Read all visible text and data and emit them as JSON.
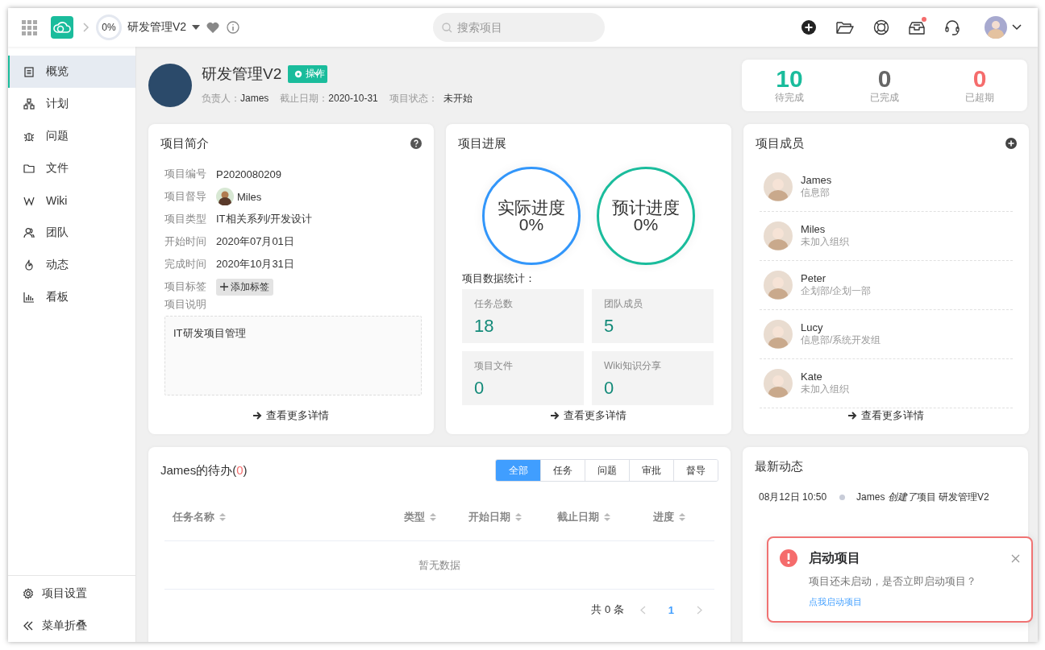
{
  "topbar": {
    "progress": "0%",
    "project_title": "研发管理V2",
    "search": {
      "placeholder": "搜索项目"
    },
    "inbox_has_new": true
  },
  "sidebar": {
    "items": [
      {
        "label": "概览",
        "selected": true
      },
      {
        "label": "计划",
        "selected": false
      },
      {
        "label": "问题",
        "selected": false
      },
      {
        "label": "文件",
        "selected": false
      },
      {
        "label": "Wiki",
        "selected": false
      },
      {
        "label": "团队",
        "selected": false
      },
      {
        "label": "动态",
        "selected": false
      },
      {
        "label": "看板",
        "selected": false
      }
    ],
    "footer": [
      {
        "label": "项目设置"
      },
      {
        "label": "菜单折叠"
      }
    ]
  },
  "project": {
    "title": "研发管理V2",
    "action_button": "操作",
    "meta": [
      {
        "label": "负责人：",
        "value": "James",
        "kind": "text"
      },
      {
        "label": "截止日期：",
        "value": "2020-10-31",
        "kind": "text"
      },
      {
        "label": "项目状态：",
        "value": "未开始",
        "kind": "tag"
      }
    ]
  },
  "summary": [
    {
      "value": "10",
      "label": "待完成",
      "color": "#1abc9c"
    },
    {
      "value": "0",
      "label": "已完成",
      "color": "#666666"
    },
    {
      "value": "0",
      "label": "已超期",
      "color": "#f56c6c"
    }
  ],
  "intro": {
    "title": "项目简介",
    "fields": [
      {
        "label": "项目编号",
        "value": "P2020080209",
        "kind": "text"
      },
      {
        "label": "项目督导",
        "value": "Miles",
        "kind": "person"
      },
      {
        "label": "项目类型",
        "value": "IT相关系列/开发设计",
        "kind": "text"
      },
      {
        "label": "开始时间",
        "value": "2020年07月01日",
        "kind": "text"
      },
      {
        "label": "完成时间",
        "value": "2020年10月31日",
        "kind": "text"
      },
      {
        "label": "项目标签",
        "value": "添加标签",
        "kind": "add"
      },
      {
        "label": "项目说明",
        "value": "IT研发项目管理",
        "kind": "description"
      }
    ],
    "more": "查看更多详情"
  },
  "progress": {
    "title": "项目进展",
    "rings": [
      {
        "label": "实际进度",
        "value": "0%",
        "color": "#3296fa"
      },
      {
        "label": "预计进度",
        "value": "0%",
        "color": "#1abc9c"
      }
    ],
    "stats_title": "项目数据统计：",
    "stats": [
      {
        "label": "任务总数",
        "value": "18"
      },
      {
        "label": "团队成员",
        "value": "5"
      },
      {
        "label": "项目文件",
        "value": "0"
      },
      {
        "label": "Wiki知识分享",
        "value": "0"
      }
    ],
    "more": "查看更多详情"
  },
  "members": {
    "title": "项目成员",
    "items": [
      {
        "name": "James",
        "dept": "信息部"
      },
      {
        "name": "Miles",
        "dept": "未加入组织"
      },
      {
        "name": "Peter",
        "dept": "企划部/企划一部"
      },
      {
        "name": "Lucy",
        "dept": "信息部/系统开发组"
      },
      {
        "name": "Kate",
        "dept": "未加入组织"
      }
    ],
    "more": "查看更多详情"
  },
  "todo": {
    "title": "James的待办(",
    "count": "0",
    "title_end": ")",
    "tabs": [
      {
        "label": "全部",
        "selected": true
      },
      {
        "label": "任务",
        "selected": false
      },
      {
        "label": "问题",
        "selected": false
      },
      {
        "label": "审批",
        "selected": false
      },
      {
        "label": "督导",
        "selected": false
      }
    ],
    "columns": [
      "任务名称",
      "类型",
      "开始日期",
      "截止日期",
      "进度"
    ],
    "empty": "暂无数据",
    "total": "共 0 条",
    "pages": [
      {
        "label": "1",
        "selected": true
      }
    ]
  },
  "activity": {
    "title": "最新动态",
    "items": [
      {
        "time": "08月12日 10:50",
        "actor": "James",
        "action": "创建了",
        "object": "项目 研发管理V2"
      }
    ]
  },
  "notification": {
    "title": "启动项目",
    "message": "项目还未启动，是否立即启动项目？",
    "link": "点我启动项目"
  }
}
